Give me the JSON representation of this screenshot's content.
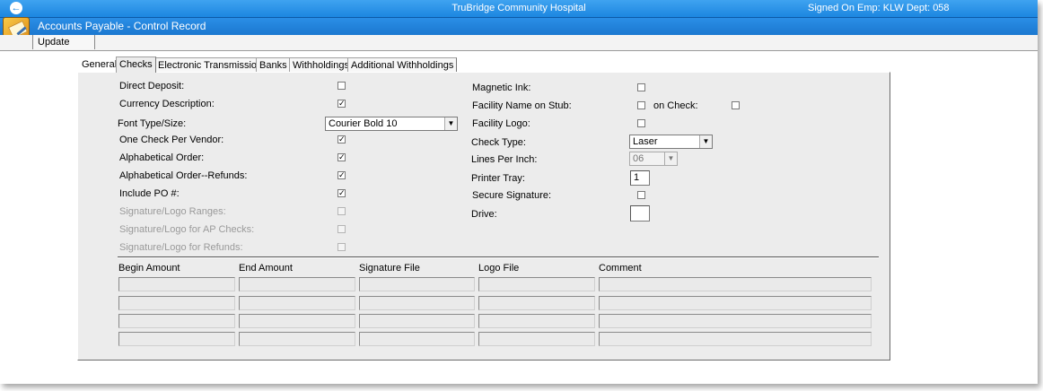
{
  "topbar": {
    "hospital": "TruBridge Community Hospital",
    "signon": "Signed On Emp: KLW  Dept: 058",
    "back_glyph": "←"
  },
  "module": {
    "title": "Accounts Payable - Control Record"
  },
  "menu": {
    "update": "Update"
  },
  "tabs": [
    {
      "label": "General",
      "active": false
    },
    {
      "label": "Checks",
      "active": true
    },
    {
      "label": "Electronic Transmission",
      "active": false
    },
    {
      "label": "Banks",
      "active": false
    },
    {
      "label": "Withholdings",
      "active": false
    },
    {
      "label": "Additional Withholdings",
      "active": false
    }
  ],
  "left_fields": {
    "direct_deposit": {
      "label": "Direct Deposit:",
      "checked": false
    },
    "currency_description": {
      "label": "Currency Description:",
      "checked": true
    },
    "font_type_size": {
      "label": "Font Type/Size:",
      "value": "Courier Bold 10"
    },
    "one_check_per_vendor": {
      "label": "One Check Per Vendor:",
      "checked": true
    },
    "alphabetical_order": {
      "label": "Alphabetical Order:",
      "checked": true
    },
    "alphabetical_order_refunds": {
      "label": "Alphabetical Order--Refunds:",
      "checked": true
    },
    "include_po": {
      "label": "Include PO #:",
      "checked": true
    },
    "signature_logo_ranges": {
      "label": "Signature/Logo Ranges:",
      "checked": false
    },
    "signature_logo_ap_checks": {
      "label": "Signature/Logo for AP Checks:",
      "checked": false
    },
    "signature_logo_refunds": {
      "label": "Signature/Logo for Refunds:",
      "checked": false
    }
  },
  "right_fields": {
    "magnetic_ink": {
      "label": "Magnetic Ink:",
      "checked": false
    },
    "facility_name_on_stub": {
      "label": "Facility Name on Stub:",
      "checked": false
    },
    "on_check": {
      "label": "on Check:",
      "checked": false
    },
    "facility_logo": {
      "label": "Facility Logo:",
      "checked": false
    },
    "check_type": {
      "label": "Check Type:",
      "value": "Laser"
    },
    "lines_per_inch": {
      "label": "Lines Per Inch:",
      "value": "06"
    },
    "printer_tray": {
      "label": "Printer Tray:",
      "value": "1"
    },
    "secure_signature": {
      "label": "Secure Signature:",
      "checked": false
    },
    "drive": {
      "label": "Drive:",
      "value": ""
    }
  },
  "grid": {
    "columns": [
      "Begin Amount",
      "End Amount",
      "Signature File",
      "Logo File",
      "Comment"
    ],
    "rows": [
      [
        "",
        "",
        "",
        "",
        ""
      ],
      [
        "",
        "",
        "",
        "",
        ""
      ],
      [
        "",
        "",
        "",
        "",
        ""
      ],
      [
        "",
        "",
        "",
        "",
        ""
      ]
    ]
  },
  "icons": {
    "checkmark": "✓",
    "dropdown": "▼",
    "app": "accounts-payable-icon"
  },
  "colors": {
    "title_bar": "#1c86e0",
    "panel": "#ececec",
    "disabled_text": "#9a9a9a"
  }
}
